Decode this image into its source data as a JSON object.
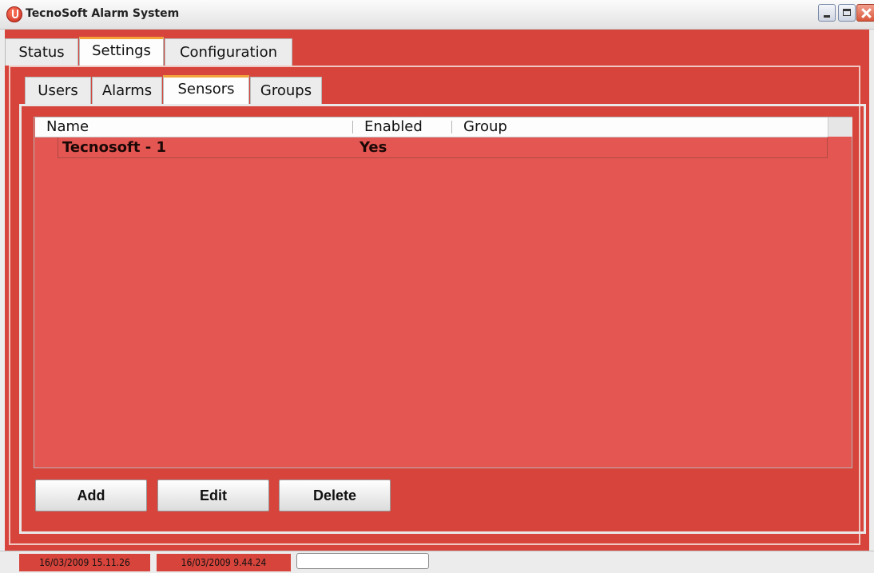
{
  "window": {
    "title": "TecnoSoft Alarm System"
  },
  "main_tabs": [
    {
      "label": "Status"
    },
    {
      "label": "Settings"
    },
    {
      "label": "Configuration"
    }
  ],
  "settings_tabs": [
    {
      "label": "Users"
    },
    {
      "label": "Alarms"
    },
    {
      "label": "Sensors"
    },
    {
      "label": "Groups"
    }
  ],
  "sensors_table": {
    "columns": [
      "Name",
      "Enabled",
      "Group"
    ],
    "rows": [
      {
        "name": "Tecnosoft - 1",
        "enabled": "Yes",
        "group": ""
      }
    ]
  },
  "buttons": {
    "add": "Add",
    "edit": "Edit",
    "delete": "Delete"
  },
  "statusbar": {
    "time_1": "16/03/2009 15.11.26",
    "time_2": "16/03/2009 9.44.24"
  },
  "colors": {
    "accent": "#d6443b",
    "table_bg": "#e35652",
    "active_tab_marker": "#f3a23a"
  }
}
